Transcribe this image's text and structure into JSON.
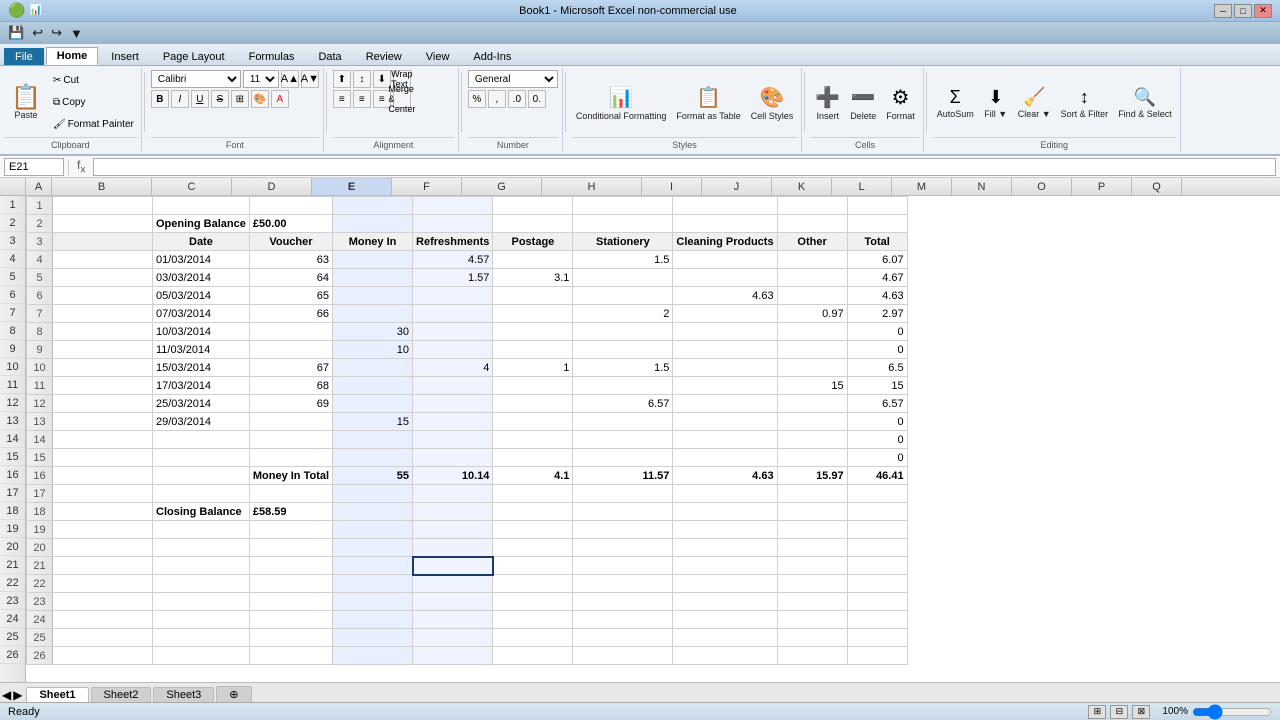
{
  "titleBar": {
    "title": "Book1 - Microsoft Excel non-commercial use",
    "controls": [
      "─",
      "□",
      "✕"
    ]
  },
  "quickAccess": {
    "buttons": [
      "💾",
      "↩",
      "↪",
      "▶",
      "☰"
    ]
  },
  "ribbonTabs": {
    "tabs": [
      "File",
      "Home",
      "Insert",
      "Page Layout",
      "Formulas",
      "Data",
      "Review",
      "View",
      "Add-Ins"
    ],
    "activeTab": "Home"
  },
  "ribbon": {
    "groups": [
      {
        "name": "Clipboard",
        "items": [
          {
            "label": "Paste",
            "icon": "📋"
          },
          {
            "label": "Cut",
            "icon": "✂"
          },
          {
            "label": "Copy",
            "icon": "⧉"
          },
          {
            "label": "Format Painter",
            "icon": "🖌"
          }
        ]
      },
      {
        "name": "Font",
        "font": "Calibri",
        "size": "11",
        "buttons": [
          "B",
          "I",
          "U",
          "S"
        ]
      },
      {
        "name": "Alignment",
        "items": [
          "≡",
          "≡",
          "≡",
          "⊞",
          "Wrap Text",
          "Merge & Center"
        ]
      },
      {
        "name": "Number",
        "format": "General"
      },
      {
        "name": "Styles",
        "items": [
          "Conditional Formatting",
          "Format as Table",
          "Cell Styles"
        ]
      },
      {
        "name": "Cells",
        "items": [
          "Insert",
          "Delete",
          "Format"
        ]
      },
      {
        "name": "Editing",
        "items": [
          "AutoSum",
          "Fill",
          "Clear",
          "Sort & Filter",
          "Find & Select"
        ]
      }
    ]
  },
  "formulaBar": {
    "cellRef": "E21",
    "formula": ""
  },
  "columnHeaders": [
    "A",
    "B",
    "C",
    "D",
    "E",
    "F",
    "G",
    "H",
    "I",
    "J",
    "K",
    "L",
    "M",
    "N",
    "O",
    "P",
    "Q"
  ],
  "rows": [
    {
      "id": 1,
      "cells": [
        "",
        "",
        "",
        "",
        "",
        "",
        "",
        "",
        "",
        ""
      ]
    },
    {
      "id": 2,
      "cells": [
        "",
        "Opening Balance",
        "£50.00",
        "",
        "",
        "",
        "",
        "",
        "",
        ""
      ]
    },
    {
      "id": 3,
      "cells": [
        "",
        "Date",
        "Voucher",
        "Money In",
        "Refreshments",
        "Postage",
        "Stationery",
        "Cleaning Products",
        "Other",
        "Total"
      ]
    },
    {
      "id": 4,
      "cells": [
        "",
        "01/03/2014",
        "63",
        "",
        "4.57",
        "",
        "1.5",
        "",
        "",
        "6.07"
      ]
    },
    {
      "id": 5,
      "cells": [
        "",
        "03/03/2014",
        "64",
        "",
        "1.57",
        "3.1",
        "",
        "",
        "",
        "4.67"
      ]
    },
    {
      "id": 6,
      "cells": [
        "",
        "05/03/2014",
        "65",
        "",
        "",
        "",
        "",
        "4.63",
        "",
        "4.63"
      ]
    },
    {
      "id": 7,
      "cells": [
        "",
        "07/03/2014",
        "66",
        "",
        "",
        "",
        "2",
        "",
        "0.97",
        "2.97"
      ]
    },
    {
      "id": 8,
      "cells": [
        "",
        "10/03/2014",
        "",
        "30",
        "",
        "",
        "",
        "",
        "",
        "0"
      ]
    },
    {
      "id": 9,
      "cells": [
        "",
        "11/03/2014",
        "",
        "10",
        "",
        "",
        "",
        "",
        "",
        "0"
      ]
    },
    {
      "id": 10,
      "cells": [
        "",
        "15/03/2014",
        "67",
        "",
        "4",
        "1",
        "1.5",
        "",
        "",
        "6.5"
      ]
    },
    {
      "id": 11,
      "cells": [
        "",
        "17/03/2014",
        "68",
        "",
        "",
        "",
        "",
        "",
        "15",
        "15"
      ]
    },
    {
      "id": 12,
      "cells": [
        "",
        "25/03/2014",
        "69",
        "",
        "",
        "",
        "6.57",
        "",
        "",
        "6.57"
      ]
    },
    {
      "id": 13,
      "cells": [
        "",
        "29/03/2014",
        "",
        "15",
        "",
        "",
        "",
        "",
        "",
        "0"
      ]
    },
    {
      "id": 14,
      "cells": [
        "",
        "",
        "",
        "",
        "",
        "",
        "",
        "",
        "",
        "0"
      ]
    },
    {
      "id": 15,
      "cells": [
        "",
        "",
        "",
        "",
        "",
        "",
        "",
        "",
        "",
        "0"
      ]
    },
    {
      "id": 16,
      "cells": [
        "",
        "",
        "Money In Total",
        "55",
        "10.14",
        "4.1",
        "11.57",
        "4.63",
        "15.97",
        "46.41"
      ]
    },
    {
      "id": 17,
      "cells": [
        "",
        "",
        "",
        "",
        "",
        "",
        "",
        "",
        "",
        ""
      ]
    },
    {
      "id": 18,
      "cells": [
        "",
        "Closing Balance",
        "£58.59",
        "",
        "",
        "",
        "",
        "",
        "",
        ""
      ]
    },
    {
      "id": 19,
      "cells": [
        "",
        "",
        "",
        "",
        "",
        "",
        "",
        "",
        "",
        ""
      ]
    },
    {
      "id": 20,
      "cells": [
        "",
        "",
        "",
        "",
        "",
        "",
        "",
        "",
        "",
        ""
      ]
    },
    {
      "id": 21,
      "cells": [
        "",
        "",
        "",
        "",
        "",
        "",
        "",
        "",
        "",
        ""
      ]
    },
    {
      "id": 22,
      "cells": [
        "",
        "",
        "",
        "",
        "",
        "",
        "",
        "",
        "",
        ""
      ]
    },
    {
      "id": 23,
      "cells": [
        "",
        "",
        "",
        "",
        "",
        "",
        "",
        "",
        "",
        ""
      ]
    },
    {
      "id": 24,
      "cells": [
        "",
        "",
        "",
        "",
        "",
        "",
        "",
        "",
        "",
        ""
      ]
    },
    {
      "id": 25,
      "cells": [
        "",
        "",
        "",
        "",
        "",
        "",
        "",
        "",
        "",
        ""
      ]
    },
    {
      "id": 26,
      "cells": [
        "",
        "",
        "",
        "",
        "",
        "",
        "",
        "",
        "",
        ""
      ]
    }
  ],
  "sheetTabs": [
    "Sheet1",
    "Sheet2",
    "Sheet3"
  ],
  "activeSheet": "Sheet1",
  "statusBar": {
    "text": "Ready",
    "zoom": "100%"
  }
}
